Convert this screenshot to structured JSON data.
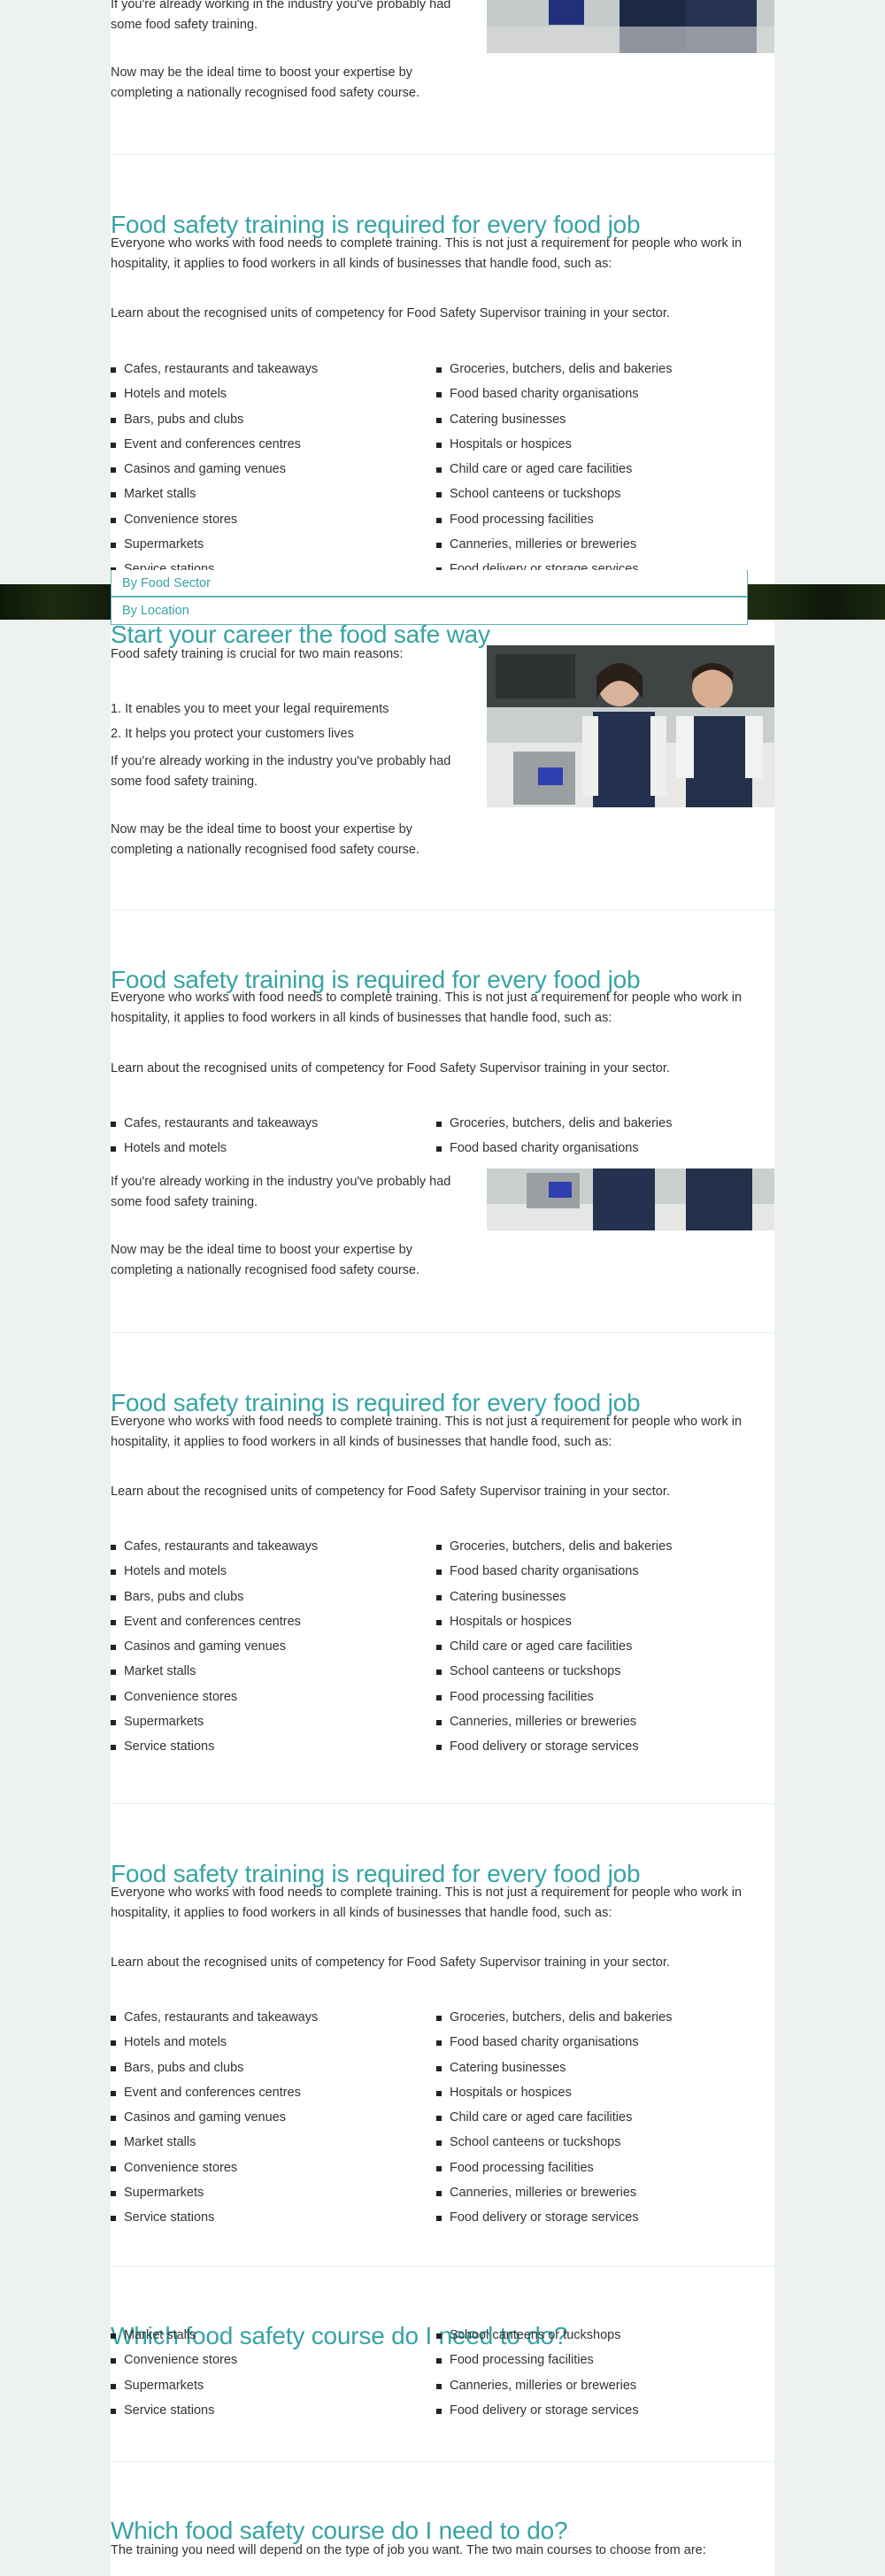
{
  "page": {
    "background": "#edf2f1",
    "accent": "#38a3a5"
  },
  "intro": {
    "experience_text": "If you're already working in the industry you've probably had some food safety training.",
    "boost_text": "Now may be the ideal time to boost your expertise by completing a nationally recognised food safety course."
  },
  "required": {
    "heading": "Food safety training is required for every food job",
    "intro": "Everyone who works with food needs to complete training. This is not just a requirement for people who work in hospitality, it applies to food workers in all kinds of businesses that handle food, such as:",
    "competency": "Learn about the recognised units of competency for Food Safety Supervisor training in your sector.",
    "left_items": [
      "Cafes, restaurants and takeaways",
      "Hotels and motels",
      "Bars, pubs and clubs",
      "Event and conferences centres",
      "Casinos and gaming venues",
      "Market stalls",
      "Convenience stores",
      "Supermarkets",
      "Service stations"
    ],
    "right_items": [
      "Groceries, butchers, delis and bakeries",
      "Food based charity organisations",
      "Catering businesses",
      "Hospitals or hospices",
      "Child care or aged care facilities",
      "School canteens or tuckshops",
      "Food processing facilities",
      "Canneries, milleries or breweries",
      "Food delivery or storage services"
    ]
  },
  "dropdown": {
    "sector_label": "By Food Sector",
    "location_label": "By Location"
  },
  "career": {
    "heading": "Start your career the food safe way",
    "intro": "Food safety training is crucial for two main reasons:",
    "reasons": [
      "1. It enables you to meet your legal requirements",
      "2. It helps you protect your customers lives"
    ]
  },
  "which": {
    "heading": "Which food safety course do I need to do?",
    "intro": "The training you need will depend on the type of job you want. The two main courses to choose from are:"
  },
  "images": {
    "photo_icon": "chef-staff-photo"
  }
}
